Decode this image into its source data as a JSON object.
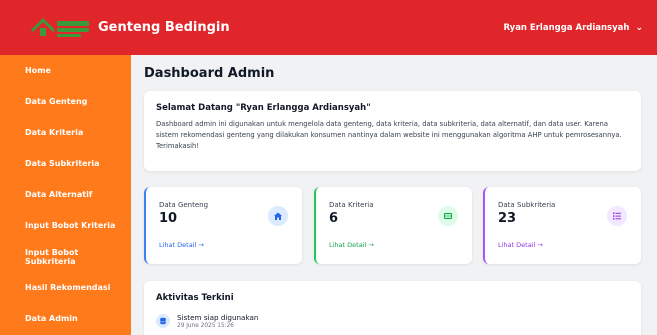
{
  "header": {
    "title": "Genteng Bedingin",
    "user_name": "Ryan Erlangga Ardiansyah",
    "colors": {
      "bar": "#e0262b",
      "logo": "#3a9a3a"
    }
  },
  "sidebar": {
    "color": "#ff7a1a",
    "items": [
      {
        "label": "Home"
      },
      {
        "label": "Data Genteng"
      },
      {
        "label": "Data Kriteria"
      },
      {
        "label": "Data Subkriteria"
      },
      {
        "label": "Data Alternatif"
      },
      {
        "label": "Input Bobot Kriteria"
      },
      {
        "label": "Input Bobot Subkriteria"
      },
      {
        "label": "Hasil Rekomendasi"
      },
      {
        "label": "Data Admin"
      }
    ]
  },
  "main": {
    "title": "Dashboard Admin",
    "welcome": {
      "title": "Selamat Datang \"Ryan Erlangga Ardiansyah\"",
      "text": "Dashboard admin ini digunakan untuk mengelola data genteng, data kriteria, data subkriteria, data alternatif, dan data user. Karena sistem rekomendasi genteng yang dilakukan konsumen nantinya dalam website ini menggunakan algoritma AHP untuk pemrosesannya. Terimakasih!"
    },
    "stats": [
      {
        "label": "Data Genteng",
        "value": "10",
        "link": "Lihat Detail →",
        "icon": "home-icon",
        "color": "#3b82f6"
      },
      {
        "label": "Data Kriteria",
        "value": "6",
        "link": "Lihat Detail →",
        "icon": "table-icon",
        "color": "#22c55e"
      },
      {
        "label": "Data Subkriteria",
        "value": "23",
        "link": "Lihat Detail →",
        "icon": "list-icon",
        "color": "#a855f7"
      }
    ],
    "activity": {
      "title": "Aktivitas Terkini",
      "items": [
        {
          "text": "Sistem siap digunakan",
          "time": "29 June 2025 15:26",
          "icon": "database-icon"
        }
      ]
    }
  }
}
